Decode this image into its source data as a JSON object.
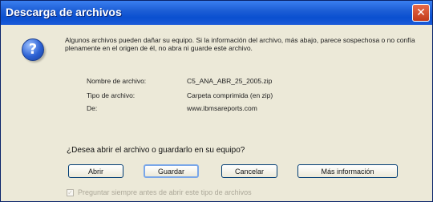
{
  "window": {
    "title": "Descarga de archivos",
    "close_glyph": "✕"
  },
  "icon": {
    "name": "question-icon",
    "glyph": "?"
  },
  "warning": {
    "text": "Algunos archivos pueden dañar su equipo. Si la información del archivo, más abajo, parece sospechosa o no confía plenamente en el origen de él, no abra ni guarde este archivo."
  },
  "file_info": {
    "name_label": "Nombre de archivo:",
    "name_value": "C5_ANA_ABR_25_2005.zip",
    "type_label": "Tipo de archivo:",
    "type_value": "Carpeta comprimida (en zip)",
    "from_label": "De:",
    "from_value": "www.ibmsareports.com"
  },
  "prompt": "¿Desea abrir el archivo o guardarlo en su equipo?",
  "buttons": {
    "open": "Abrir",
    "save": "Guardar",
    "cancel": "Cancelar",
    "more_info": "Más información"
  },
  "checkbox": {
    "label": "Preguntar siempre antes de abrir este tipo de archivos",
    "checked": true,
    "check_glyph": "✓"
  }
}
